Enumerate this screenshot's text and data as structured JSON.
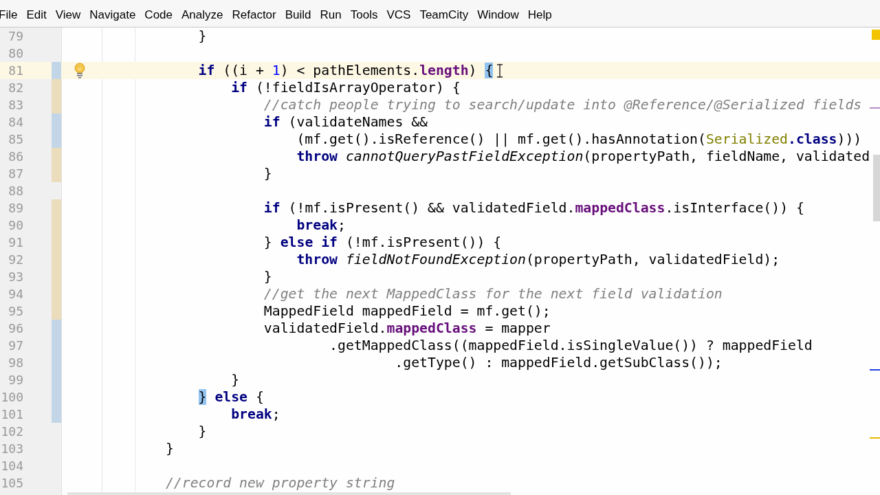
{
  "menu": [
    {
      "label": "File"
    },
    {
      "label": "Edit"
    },
    {
      "label": "View"
    },
    {
      "label": "Navigate"
    },
    {
      "label": "Code"
    },
    {
      "label": "Analyze"
    },
    {
      "label": "Refactor"
    },
    {
      "label": "Build"
    },
    {
      "label": "Run"
    },
    {
      "label": "Tools"
    },
    {
      "label": "VCS"
    },
    {
      "label": "TeamCity"
    },
    {
      "label": "Window"
    },
    {
      "label": "Help"
    }
  ],
  "editor": {
    "lines": [
      {
        "number": "79",
        "kind": "unchanged",
        "current": false,
        "bulb": false,
        "mouse_cursor": false,
        "tokens": [
          {
            "text": "                }",
            "kind": "plain"
          }
        ]
      },
      {
        "number": "80",
        "kind": "unchanged",
        "current": false,
        "bulb": false,
        "mouse_cursor": false
      },
      {
        "number": "81",
        "kind": "modified",
        "current": true,
        "bulb": true,
        "mouse_cursor": true,
        "tokens": [
          {
            "text": "                if",
            "kind": "kw"
          },
          {
            "text": " ((i + ",
            "kind": "plain"
          },
          {
            "text": "1",
            "kind": "num"
          },
          {
            "text": ") < pathElements.",
            "kind": "plain"
          },
          {
            "text": "length",
            "kind": "field"
          },
          {
            "text": ") ",
            "kind": "plain"
          },
          {
            "text": "{",
            "kind": "match"
          }
        ]
      },
      {
        "number": "82",
        "kind": "added",
        "current": false,
        "bulb": false,
        "mouse_cursor": false,
        "tokens": [
          {
            "text": "                    if",
            "kind": "kw"
          },
          {
            "text": " (!fieldIsArrayOperator) {",
            "kind": "plain"
          }
        ]
      },
      {
        "number": "83",
        "kind": "added",
        "current": false,
        "bulb": false,
        "mouse_cursor": false,
        "tokens": [
          {
            "text": "                        //catch people trying to search/update into @Reference/@Serialized fields",
            "kind": "comment"
          }
        ]
      },
      {
        "number": "84",
        "kind": "modified",
        "current": false,
        "bulb": false,
        "mouse_cursor": false,
        "tokens": [
          {
            "text": "                        if",
            "kind": "kw"
          },
          {
            "text": " (validateNames &&",
            "kind": "plain"
          }
        ]
      },
      {
        "number": "85",
        "kind": "modified",
        "current": false,
        "bulb": false,
        "mouse_cursor": false,
        "tokens": [
          {
            "text": "                            (mf.get().isReference() || mf.get().hasAnnotation(",
            "kind": "plain"
          },
          {
            "text": "Serialized",
            "kind": "cls"
          },
          {
            "text": ".class",
            "kind": "kw"
          },
          {
            "text": ")))",
            "kind": "plain"
          }
        ]
      },
      {
        "number": "86",
        "kind": "added",
        "current": false,
        "bulb": false,
        "mouse_cursor": false,
        "tokens": [
          {
            "text": "                            throw",
            "kind": "kw"
          },
          {
            "text": " cannotQueryPastFieldException",
            "kind": "static"
          },
          {
            "text": "(propertyPath, fieldName, validated",
            "kind": "plain"
          }
        ]
      },
      {
        "number": "87",
        "kind": "added",
        "current": false,
        "bulb": false,
        "mouse_cursor": false,
        "tokens": [
          {
            "text": "                        }",
            "kind": "plain"
          }
        ]
      },
      {
        "number": "88",
        "kind": "unchanged",
        "current": false,
        "bulb": false,
        "mouse_cursor": false
      },
      {
        "number": "89",
        "kind": "added",
        "current": false,
        "bulb": false,
        "mouse_cursor": false,
        "tokens": [
          {
            "text": "                        if",
            "kind": "kw"
          },
          {
            "text": " (!mf.isPresent() && validatedField.",
            "kind": "plain"
          },
          {
            "text": "mappedClass",
            "kind": "field"
          },
          {
            "text": ".isInterface()) {",
            "kind": "plain"
          }
        ]
      },
      {
        "number": "90",
        "kind": "added",
        "current": false,
        "bulb": false,
        "mouse_cursor": false,
        "tokens": [
          {
            "text": "                            break",
            "kind": "kw"
          },
          {
            "text": ";",
            "kind": "plain"
          }
        ]
      },
      {
        "number": "91",
        "kind": "added",
        "current": false,
        "bulb": false,
        "mouse_cursor": false,
        "tokens": [
          {
            "text": "                        } ",
            "kind": "plain"
          },
          {
            "text": "else if",
            "kind": "kw"
          },
          {
            "text": " (!mf.isPresent()) {",
            "kind": "plain"
          }
        ]
      },
      {
        "number": "92",
        "kind": "added",
        "current": false,
        "bulb": false,
        "mouse_cursor": false,
        "tokens": [
          {
            "text": "                            throw",
            "kind": "kw"
          },
          {
            "text": " fieldNotFoundException",
            "kind": "static"
          },
          {
            "text": "(propertyPath, validatedField);",
            "kind": "plain"
          }
        ]
      },
      {
        "number": "93",
        "kind": "added",
        "current": false,
        "bulb": false,
        "mouse_cursor": false,
        "tokens": [
          {
            "text": "                        }",
            "kind": "plain"
          }
        ]
      },
      {
        "number": "94",
        "kind": "added",
        "current": false,
        "bulb": false,
        "mouse_cursor": false,
        "tokens": [
          {
            "text": "                        //get the next MappedClass for the next field validation",
            "kind": "comment"
          }
        ]
      },
      {
        "number": "95",
        "kind": "added",
        "current": false,
        "bulb": false,
        "mouse_cursor": false,
        "tokens": [
          {
            "text": "                        MappedField mappedField = mf.get();",
            "kind": "plain"
          }
        ]
      },
      {
        "number": "96",
        "kind": "modified",
        "current": false,
        "bulb": false,
        "mouse_cursor": false,
        "tokens": [
          {
            "text": "                        validatedField.",
            "kind": "plain"
          },
          {
            "text": "mappedClass",
            "kind": "field"
          },
          {
            "text": " = mapper",
            "kind": "plain"
          }
        ]
      },
      {
        "number": "97",
        "kind": "modified",
        "current": false,
        "bulb": false,
        "mouse_cursor": false,
        "tokens": [
          {
            "text": "                                .getMappedClass((mappedField.isSingleValue()) ? mappedField",
            "kind": "plain"
          }
        ]
      },
      {
        "number": "98",
        "kind": "modified",
        "current": false,
        "bulb": false,
        "mouse_cursor": false,
        "tokens": [
          {
            "text": "                                        .getType() : mappedField.getSubClass());",
            "kind": "plain"
          }
        ]
      },
      {
        "number": "99",
        "kind": "modified",
        "current": false,
        "bulb": false,
        "mouse_cursor": false,
        "tokens": [
          {
            "text": "                    }",
            "kind": "plain"
          }
        ]
      },
      {
        "number": "100",
        "kind": "modified",
        "current": false,
        "bulb": false,
        "mouse_cursor": false,
        "tokens": [
          {
            "text": "                }",
            "kind": "match"
          },
          {
            "text": " else",
            "kind": "kw"
          },
          {
            "text": " {",
            "kind": "plain"
          }
        ]
      },
      {
        "number": "101",
        "kind": "modified",
        "current": false,
        "bulb": false,
        "mouse_cursor": false,
        "tokens": [
          {
            "text": "                    break",
            "kind": "kw"
          },
          {
            "text": ";",
            "kind": "plain"
          }
        ]
      },
      {
        "number": "102",
        "kind": "unchanged",
        "current": false,
        "bulb": false,
        "mouse_cursor": false,
        "tokens": [
          {
            "text": "                }",
            "kind": "plain"
          }
        ]
      },
      {
        "number": "103",
        "kind": "unchanged",
        "current": false,
        "bulb": false,
        "mouse_cursor": false,
        "tokens": [
          {
            "text": "            }",
            "kind": "plain"
          }
        ]
      },
      {
        "number": "104",
        "kind": "unchanged",
        "current": false,
        "bulb": false,
        "mouse_cursor": false
      },
      {
        "number": "105",
        "kind": "unchanged",
        "current": false,
        "bulb": false,
        "mouse_cursor": false,
        "tokens": [
          {
            "text": "            //record new property string",
            "kind": "comment"
          }
        ]
      }
    ]
  }
}
